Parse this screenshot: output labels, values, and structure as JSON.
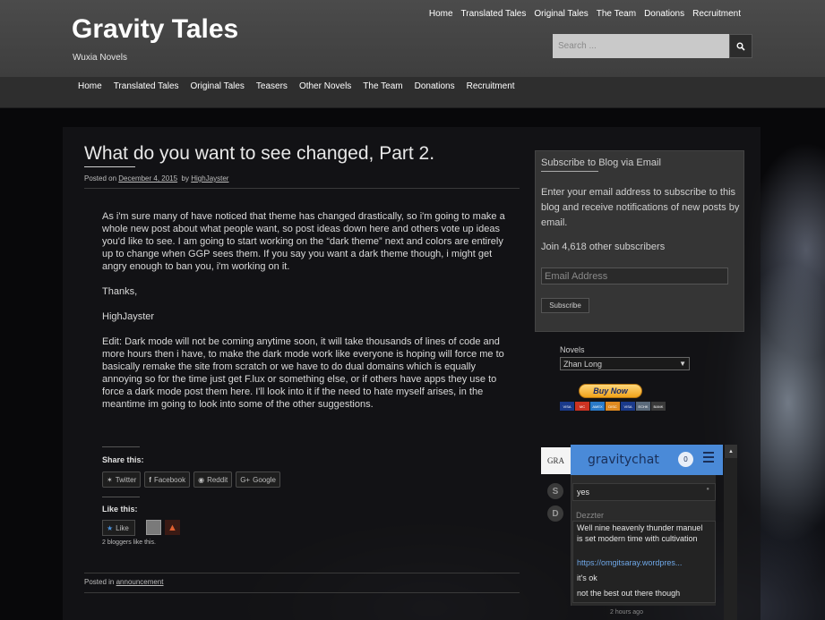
{
  "site": {
    "title": "Gravity Tales",
    "description": "Wuxia Novels"
  },
  "top_nav": [
    "Home",
    "Translated Tales",
    "Original Tales",
    "The Team",
    "Donations",
    "Recruitment"
  ],
  "search": {
    "placeholder": "Search ...",
    "icon": "search-icon"
  },
  "main_nav": [
    "Home",
    "Translated Tales",
    "Original Tales",
    "Teasers",
    "Other Novels",
    "The Team",
    "Donations",
    "Recruitment"
  ],
  "post": {
    "title": "What do you want to see changed, Part 2.",
    "meta_posted_on": "Posted on",
    "meta_date": "December 4, 2015",
    "meta_by": "by",
    "meta_author": "HighJayster",
    "paragraphs": [
      "As i'm sure many of have noticed that theme has changed drastically, so i'm going to make a whole new post about what people want, so post ideas down here and others vote up ideas you'd like to see. I am going to start working on the “dark theme” next and colors are entirely up to change when GGP sees them. If you say you want a dark theme though, i might get angry enough to ban you, i'm working on it.",
      "Thanks,",
      "HighJayster",
      "Edit: Dark mode will not be coming anytime soon, it will take thousands of lines of code and more hours then i have, to make the dark mode work like everyone is hoping will force me to basically remake the site from scratch or we have to do dual domains which is equally annoying so for the time just get F.lux or something else, or if others have apps they use to force a dark mode post them here. I'll look into it if the need to hate myself arises, in the meantime im going to look into some of the other suggestions."
    ],
    "share_title": "Share this:",
    "share_buttons": [
      "Twitter",
      "Facebook",
      "Reddit",
      "Google"
    ],
    "like_title": "Like this:",
    "like_label": "Like",
    "like_count": "2 bloggers like this.",
    "posted_in_label": "Posted in",
    "category": "announcement"
  },
  "subscribe_widget": {
    "title": "Subscribe to Blog via Email",
    "text": "Enter your email address to subscribe to this blog and receive notifications of new posts by email.",
    "subscribers": "Join 4,618 other subscribers",
    "email_placeholder": "Email Address",
    "button": "Subscribe"
  },
  "novels": {
    "label": "Novels",
    "selected": "Zhan Long"
  },
  "paypal": {
    "button": "Buy Now",
    "cards": [
      "VISA",
      "MC",
      "AMEX",
      "DISC",
      "VISA",
      "ECHK",
      "BANK"
    ]
  },
  "chat": {
    "logo": "GRA",
    "title": "gravitychat",
    "count": "0",
    "avatars": [
      "S",
      "D"
    ],
    "messages": [
      {
        "text": "yes"
      },
      {
        "text": "Well nine heavenly thunder manuel is set modern time with cultivation"
      },
      {
        "text": "https://omgitsaray.wordpres...",
        "link": true
      },
      {
        "text": "it's ok"
      },
      {
        "text": "not the best out there though"
      }
    ],
    "author": "Dezzter",
    "time": "2 hours ago"
  }
}
